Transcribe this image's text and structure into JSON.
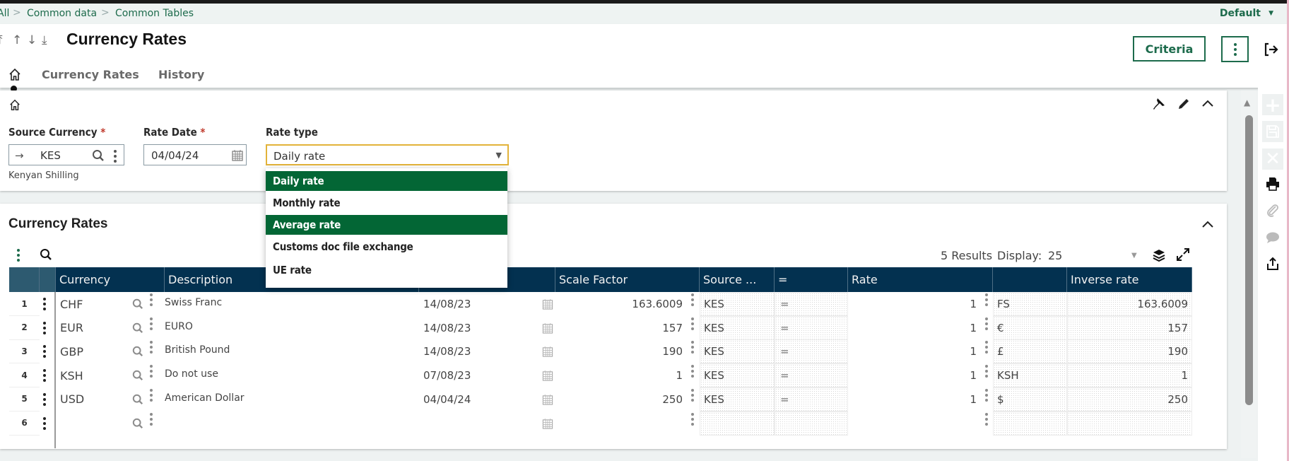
{
  "breadcrumb": {
    "items": [
      "All",
      "Common data",
      "Common Tables"
    ],
    "separator": ">"
  },
  "profile_selector": {
    "value": "Default"
  },
  "header": {
    "title": "Currency Rates",
    "nav_icons": [
      "first-record-icon",
      "previous-record-icon",
      "next-record-icon",
      "last-record-icon"
    ],
    "tabs": [
      {
        "icon": "home-icon",
        "label": ""
      },
      {
        "label": "Currency Rates"
      },
      {
        "label": "History"
      }
    ],
    "criteria_label": "Criteria"
  },
  "criteria": {
    "source_currency": {
      "label": "Source Currency",
      "required_mark": "*",
      "value": "KES",
      "description": "Kenyan Shilling"
    },
    "rate_date": {
      "label": "Rate Date",
      "required_mark": "*",
      "value": "04/04/24"
    },
    "rate_type": {
      "label": "Rate type",
      "value": "Daily rate",
      "options": [
        {
          "label": "Daily rate",
          "highlighted": true
        },
        {
          "label": "Monthly rate",
          "highlighted": false
        },
        {
          "label": "Average rate",
          "highlighted": true
        },
        {
          "label": "Customs doc file exchange",
          "highlighted": false
        },
        {
          "label": "UE rate",
          "highlighted": false
        }
      ]
    }
  },
  "rates": {
    "title": "Currency Rates",
    "results": "5 Results",
    "display_label": "Display:",
    "display_value": "25",
    "columns": [
      "Currency",
      "Description",
      "",
      "Scale Factor",
      "Source ...",
      "=",
      "Rate",
      "",
      "Inverse rate"
    ],
    "rows": [
      {
        "num": "1",
        "currency": "CHF",
        "description": "Swiss Franc",
        "date": "14/08/23",
        "scale": "163.6009",
        "source": "KES",
        "eq": "=",
        "rate": "1",
        "symbol": "FS",
        "inverse": "163.6009"
      },
      {
        "num": "2",
        "currency": "EUR",
        "description": "EURO",
        "date": "14/08/23",
        "scale": "157",
        "source": "KES",
        "eq": "=",
        "rate": "1",
        "symbol": "€",
        "inverse": "157"
      },
      {
        "num": "3",
        "currency": "GBP",
        "description": "British Pound",
        "date": "14/08/23",
        "scale": "190",
        "source": "KES",
        "eq": "=",
        "rate": "1",
        "symbol": "£",
        "inverse": "190"
      },
      {
        "num": "4",
        "currency": "KSH",
        "description": "Do not use",
        "date": "07/08/23",
        "scale": "1",
        "source": "KES",
        "eq": "=",
        "rate": "1",
        "symbol": "KSH",
        "inverse": "1"
      },
      {
        "num": "5",
        "currency": "USD",
        "description": "American Dollar",
        "date": "04/04/24",
        "scale": "250",
        "source": "KES",
        "eq": "=",
        "rate": "1",
        "symbol": "$",
        "inverse": "250"
      },
      {
        "num": "6",
        "currency": "",
        "description": "",
        "date": "",
        "scale": "",
        "source": "",
        "eq": "",
        "rate": "",
        "symbol": "",
        "inverse": ""
      }
    ]
  },
  "side_toolbar": [
    "add-icon",
    "save-icon",
    "cancel-icon",
    "print-icon",
    "attachment-icon",
    "comment-icon",
    "export-icon"
  ],
  "colors": {
    "brand_green": "#1d6b4c",
    "selected_option": "#036635",
    "table_header": "#033150",
    "focus_border": "#e2b33a",
    "required": "#c0392b"
  }
}
